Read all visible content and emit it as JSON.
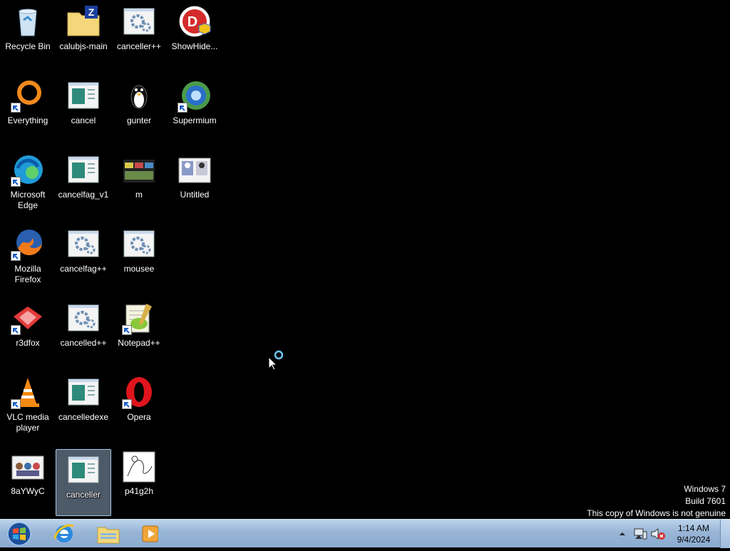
{
  "desktop": {
    "icons": [
      {
        "label": "Recycle Bin",
        "icon": "recycle-bin-icon",
        "shortcut": false
      },
      {
        "label": "calubjs-main",
        "icon": "zip-folder-icon",
        "shortcut": false
      },
      {
        "label": "canceller++",
        "icon": "app-gear-icon",
        "shortcut": false
      },
      {
        "label": "ShowHide...",
        "icon": "showhide-icon",
        "shortcut": false
      },
      {
        "label": "Everything",
        "icon": "everything-icon",
        "shortcut": true
      },
      {
        "label": "cancel",
        "icon": "exe-window-icon",
        "shortcut": false
      },
      {
        "label": "gunter",
        "icon": "penguin-icon",
        "shortcut": false
      },
      {
        "label": "Supermium",
        "icon": "supermium-icon",
        "shortcut": true
      },
      {
        "label": "Microsoft Edge",
        "icon": "edge-icon",
        "shortcut": true
      },
      {
        "label": "cancelfag_v1",
        "icon": "exe-window-icon",
        "shortcut": false
      },
      {
        "label": "m",
        "icon": "image-thumbnail-icon",
        "shortcut": false
      },
      {
        "label": "Untitled",
        "icon": "image-thumbnail-icon",
        "shortcut": false
      },
      {
        "label": "Mozilla Firefox",
        "icon": "firefox-icon",
        "shortcut": true
      },
      {
        "label": "cancelfag++",
        "icon": "app-gear-icon",
        "shortcut": false
      },
      {
        "label": "mousee",
        "icon": "app-gear-icon",
        "shortcut": false
      },
      {
        "label": "r3dfox",
        "icon": "r3dfox-icon",
        "shortcut": true
      },
      {
        "label": "cancelled++",
        "icon": "app-gear-icon",
        "shortcut": false
      },
      {
        "label": "Notepad++",
        "icon": "notepadpp-icon",
        "shortcut": true
      },
      {
        "label": "VLC media player",
        "icon": "vlc-icon",
        "shortcut": true
      },
      {
        "label": "cancelledexe",
        "icon": "exe-window-icon",
        "shortcut": false
      },
      {
        "label": "Opera",
        "icon": "opera-icon",
        "shortcut": true
      },
      {
        "label": "8aYWyC",
        "icon": "image-thumbnail-icon",
        "shortcut": false
      },
      {
        "label": "canceller",
        "icon": "exe-window-icon",
        "shortcut": false,
        "selected": true
      },
      {
        "label": "p41g2h",
        "icon": "sketch-thumbnail-icon",
        "shortcut": false
      }
    ]
  },
  "watermark": {
    "line1": "Windows 7",
    "line2": "Build 7601",
    "line3": "This copy of Windows is not genuine"
  },
  "taskbar": {
    "pinned": [
      {
        "name": "internet-explorer-icon"
      },
      {
        "name": "file-explorer-icon"
      },
      {
        "name": "media-player-icon"
      }
    ],
    "clock": {
      "time": "1:14 AM",
      "date": "9/4/2024"
    }
  },
  "colors": {
    "desktop_bg": "#000000",
    "taskbar": "#9fbbdc",
    "selection": "#aac8e6"
  }
}
